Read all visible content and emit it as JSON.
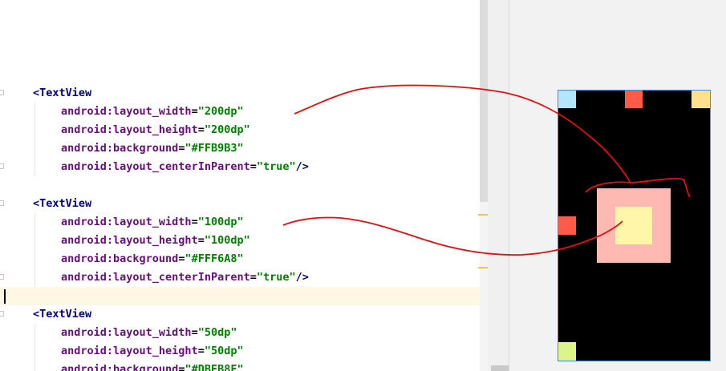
{
  "editor": {
    "lines": [
      {
        "tokens": [
          {
            "t": "<",
            "c": "tag"
          },
          {
            "t": "TextView",
            "c": "tag"
          }
        ]
      },
      {
        "tokens": [
          {
            "t": "android:",
            "c": "attr"
          },
          {
            "t": "layout_width",
            "c": "attr"
          },
          {
            "t": "=",
            "c": "plain"
          },
          {
            "t": "\"200dp\"",
            "c": "val"
          }
        ]
      },
      {
        "tokens": [
          {
            "t": "android:",
            "c": "attr"
          },
          {
            "t": "layout_height",
            "c": "attr"
          },
          {
            "t": "=",
            "c": "plain"
          },
          {
            "t": "\"200dp\"",
            "c": "val"
          }
        ]
      },
      {
        "tokens": [
          {
            "t": "android:",
            "c": "attr"
          },
          {
            "t": "background",
            "c": "attr"
          },
          {
            "t": "=",
            "c": "plain"
          },
          {
            "t": "\"#FFB9B3\"",
            "c": "val"
          }
        ]
      },
      {
        "tokens": [
          {
            "t": "android:",
            "c": "attr"
          },
          {
            "t": "layout_centerInParent",
            "c": "attr"
          },
          {
            "t": "=",
            "c": "plain"
          },
          {
            "t": "\"true\"",
            "c": "val"
          },
          {
            "t": "/>",
            "c": "tag"
          }
        ]
      },
      {
        "tokens": []
      },
      {
        "tokens": [
          {
            "t": "<",
            "c": "tag"
          },
          {
            "t": "TextView",
            "c": "tag"
          }
        ]
      },
      {
        "tokens": [
          {
            "t": "android:",
            "c": "attr"
          },
          {
            "t": "layout_width",
            "c": "attr"
          },
          {
            "t": "=",
            "c": "plain"
          },
          {
            "t": "\"100dp\"",
            "c": "val"
          }
        ]
      },
      {
        "tokens": [
          {
            "t": "android:",
            "c": "attr"
          },
          {
            "t": "layout_height",
            "c": "attr"
          },
          {
            "t": "=",
            "c": "plain"
          },
          {
            "t": "\"100dp\"",
            "c": "val"
          }
        ]
      },
      {
        "tokens": [
          {
            "t": "android:",
            "c": "attr"
          },
          {
            "t": "background",
            "c": "attr"
          },
          {
            "t": "=",
            "c": "plain"
          },
          {
            "t": "\"#FFF6A8\"",
            "c": "val"
          }
        ]
      },
      {
        "tokens": [
          {
            "t": "android:",
            "c": "attr"
          },
          {
            "t": "layout_centerInParent",
            "c": "attr"
          },
          {
            "t": "=",
            "c": "plain"
          },
          {
            "t": "\"true\"",
            "c": "val"
          },
          {
            "t": "/>",
            "c": "tag"
          }
        ]
      },
      {
        "tokens": []
      },
      {
        "tokens": [
          {
            "t": "<",
            "c": "tag"
          },
          {
            "t": "TextView",
            "c": "tag"
          }
        ]
      },
      {
        "tokens": [
          {
            "t": "android:",
            "c": "attr"
          },
          {
            "t": "layout_width",
            "c": "attr"
          },
          {
            "t": "=",
            "c": "plain"
          },
          {
            "t": "\"50dp\"",
            "c": "val"
          }
        ]
      },
      {
        "tokens": [
          {
            "t": "android:",
            "c": "attr"
          },
          {
            "t": "layout_height",
            "c": "attr"
          },
          {
            "t": "=",
            "c": "plain"
          },
          {
            "t": "\"50dp\"",
            "c": "val"
          }
        ]
      },
      {
        "tokens": [
          {
            "t": "android:",
            "c": "attr"
          },
          {
            "t": "background",
            "c": "attr"
          },
          {
            "t": "=",
            "c": "plain"
          },
          {
            "t": "\"#DBEB8F\"",
            "c": "val"
          }
        ]
      }
    ]
  },
  "preview": {
    "views": [
      {
        "name": "top-left-square",
        "color": "#b3e5fc"
      },
      {
        "name": "top-center-square",
        "color": "#ff5a4a"
      },
      {
        "name": "top-right-square",
        "color": "#ffe08c"
      },
      {
        "name": "left-center-square",
        "color": "#ff5a4a"
      },
      {
        "name": "bottom-left-square",
        "color": "#dbf58c"
      },
      {
        "name": "center-200dp-square",
        "color": "#FFB9B3"
      },
      {
        "name": "center-100dp-square",
        "color": "#FFF6A8"
      }
    ]
  },
  "annotation_color": "#e01010"
}
